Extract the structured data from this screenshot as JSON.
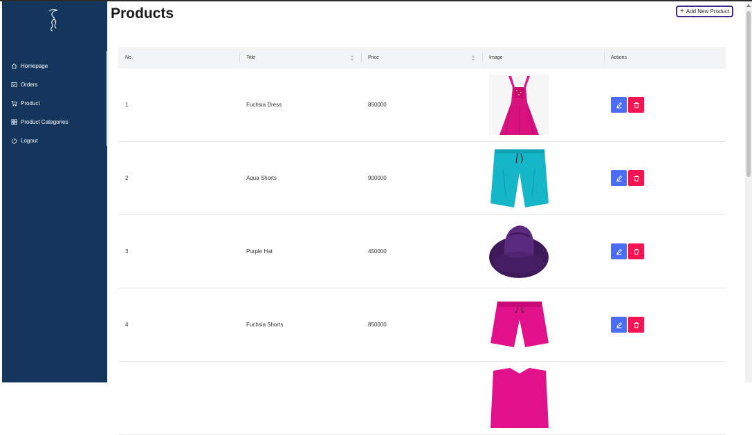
{
  "sidebar": {
    "logo_icon": "fashion-silhouette-icon",
    "background": "#15365c",
    "items": [
      {
        "label": "Homepage",
        "icon": "home-icon"
      },
      {
        "label": "Orders",
        "icon": "orders-icon"
      },
      {
        "label": "Product",
        "icon": "cart-icon"
      },
      {
        "label": "Product Categories",
        "icon": "grid-icon"
      },
      {
        "label": "Logout",
        "icon": "power-icon"
      }
    ]
  },
  "header": {
    "title": "Products",
    "add_button_label": "Add New Product",
    "add_button_icon": "plus-icon"
  },
  "table": {
    "columns": [
      "No.",
      "Title",
      "Price",
      "Image",
      "Actions"
    ],
    "sortable_columns": [
      "Title",
      "Price"
    ],
    "rows": [
      {
        "no": "1",
        "title": "Fuchsia Dress",
        "price": "850000",
        "image": "fuchsia-dress"
      },
      {
        "no": "2",
        "title": "Aqua Shorts",
        "price": "900000",
        "image": "aqua-shorts"
      },
      {
        "no": "3",
        "title": "Purple Hat",
        "price": "450000",
        "image": "purple-hat"
      },
      {
        "no": "4",
        "title": "Fuchsia Shorts",
        "price": "850000",
        "image": "fuchsia-shorts"
      }
    ],
    "actions": {
      "edit_icon": "pencil-icon",
      "delete_icon": "trash-icon",
      "edit_color": "#4a6cf7",
      "delete_color": "#f31454"
    }
  }
}
